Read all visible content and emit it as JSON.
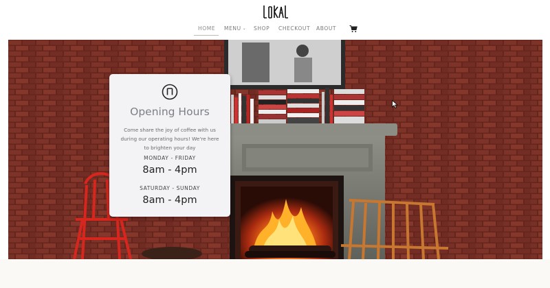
{
  "brand": {
    "logo_text": "LOKAL"
  },
  "nav": {
    "items": [
      {
        "label": "HOME"
      },
      {
        "label": "MENU"
      },
      {
        "label": "SHOP"
      },
      {
        "label": "CHECKOUT"
      },
      {
        "label": "ABOUT"
      }
    ],
    "active": "HOME",
    "menu_chevron": "chevron-down-icon",
    "cart_icon": "shopping-cart-icon"
  },
  "hours_card": {
    "icon": "lokal-badge-icon",
    "title": "Opening Hours",
    "description": "Come share the joy of coffee with us during our operating hours! We're here to brighten your day",
    "schedule": [
      {
        "days": "MONDAY - FRIDAY",
        "hours": "8am - 4pm"
      },
      {
        "days": "SATURDAY - SUNDAY",
        "hours": "8am - 4pm"
      }
    ]
  },
  "colors": {
    "brick": "#7a3328",
    "card_bg": "#f3f3f5",
    "fire": "#ff7a1a",
    "chair_red": "#d7261e"
  }
}
